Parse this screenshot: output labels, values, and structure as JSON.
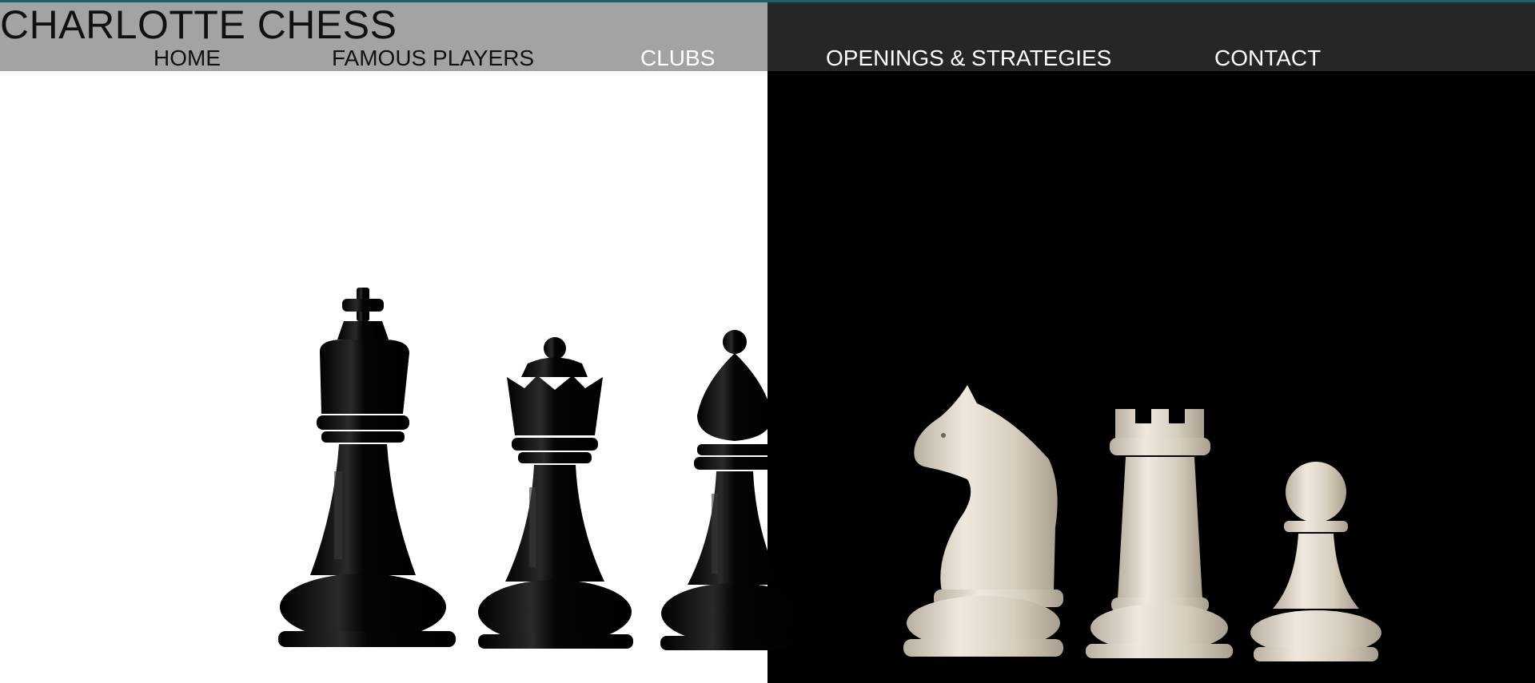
{
  "site": {
    "title": "CHARLOTTE CHESS"
  },
  "nav": {
    "home": "HOME",
    "famous_players": "FAMOUS PLAYERS",
    "clubs": "CLUBS",
    "openings": "OPENINGS & STRATEGIES",
    "contact": "CONTACT"
  },
  "hero": {
    "black_pieces": [
      "king",
      "queen",
      "bishop"
    ],
    "white_pieces": [
      "knight",
      "rook",
      "pawn"
    ]
  },
  "colors": {
    "header_left": "#a3a3a3",
    "header_right": "#262626",
    "accent_line": "#1f5f66",
    "black_piece": "#0a0a0a",
    "white_piece": "#d9d1c2"
  }
}
